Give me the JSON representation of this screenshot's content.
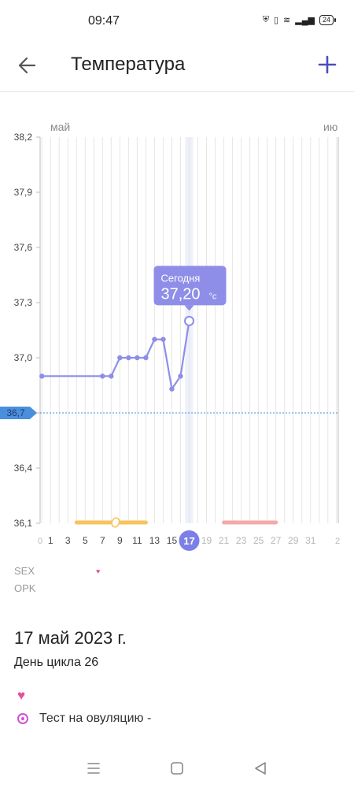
{
  "status_bar": {
    "time": "09:47",
    "battery": "24"
  },
  "header": {
    "title": "Температура"
  },
  "chart_data": {
    "type": "line",
    "months": [
      "май",
      "ию"
    ],
    "yticks": [
      "38,2",
      "37,9",
      "37,6",
      "37,3",
      "37,0",
      "36,7",
      "36,4",
      "36,1"
    ],
    "ylim": [
      36.1,
      38.2
    ],
    "xlim": [
      -0.2,
      34.2
    ],
    "xticks": [
      "1",
      "3",
      "5",
      "7",
      "9",
      "11",
      "13",
      "15",
      "19",
      "21",
      "23",
      "25",
      "27",
      "29",
      "31"
    ],
    "xtick_values": [
      1,
      3,
      5,
      7,
      9,
      11,
      13,
      15,
      19,
      21,
      23,
      25,
      27,
      29,
      31
    ],
    "edge_left_label": "0",
    "edge_right_label": "2",
    "today_label": "17",
    "today_day": 17,
    "coverline": "36,7",
    "coverline_value": 36.7,
    "series": [
      {
        "x": [
          0,
          7,
          8,
          9,
          10,
          11,
          12,
          13,
          14,
          15,
          16,
          17
        ],
        "y": [
          36.9,
          36.9,
          36.9,
          37.0,
          37.0,
          37.0,
          37.0,
          37.1,
          37.1,
          36.83,
          36.9,
          37.2
        ]
      }
    ],
    "fertile_window": [
      4,
      12
    ],
    "ovulation_day": 8.5,
    "period_window": [
      21,
      27
    ],
    "tooltip": {
      "title": "Сегодня",
      "value": "37,20",
      "unit": "°c"
    },
    "colors": {
      "line": "#8e8ee8",
      "grid": "#e6e6e6",
      "coverline": "#4a8fdc",
      "today": "#7b7fe6",
      "fertile": "#f7c35f",
      "period": "#f4a9a9"
    }
  },
  "legend": {
    "sex": "SEX",
    "opk": "OPK"
  },
  "details": {
    "date": "17 май 2023 г.",
    "cycle_day": "День цикла 26",
    "ovulation_test": "Тест на овуляцию -"
  }
}
